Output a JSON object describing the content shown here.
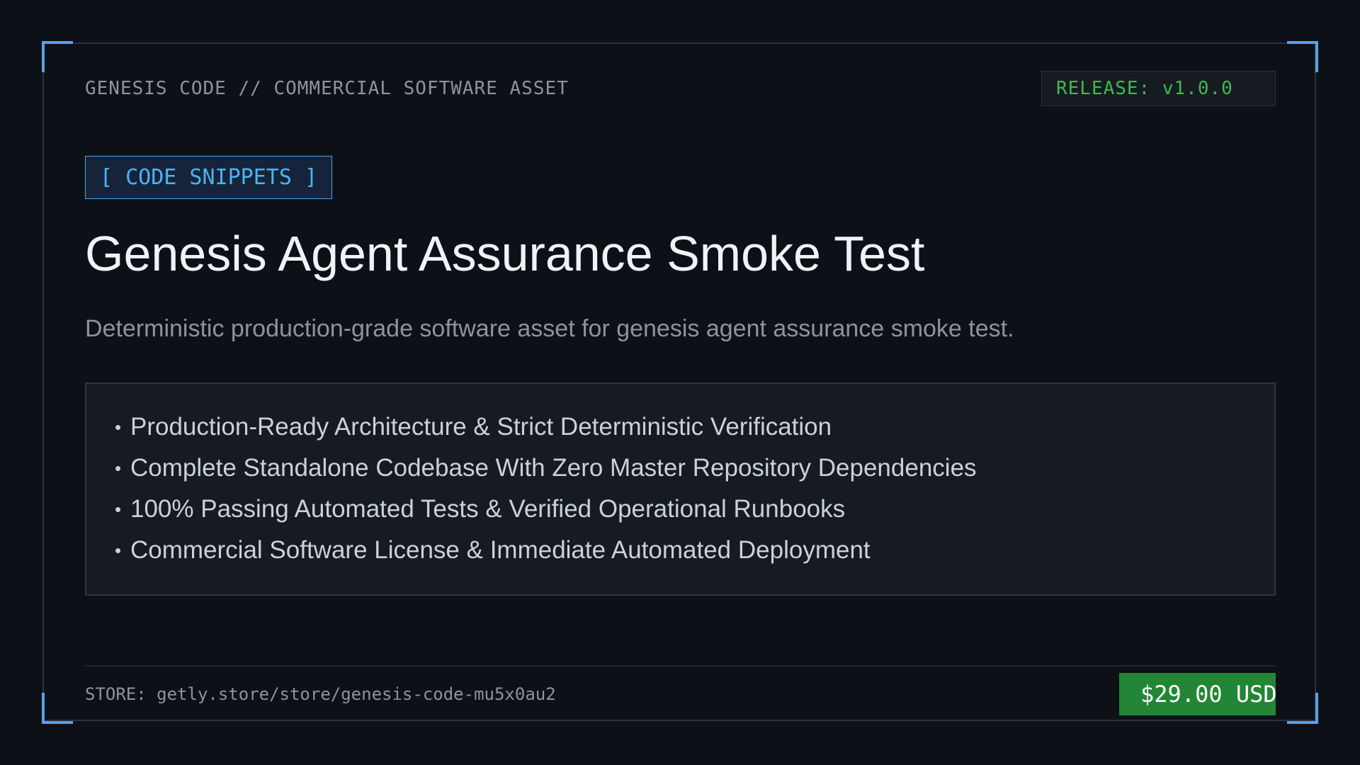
{
  "header": {
    "label": "GENESIS CODE // COMMERCIAL SOFTWARE ASSET",
    "release": "RELEASE: v1.0.0"
  },
  "category": "[ CODE SNIPPETS ]",
  "title": "Genesis Agent Assurance Smoke Test",
  "subtitle": "Deterministic production-grade software asset for genesis agent assurance smoke test.",
  "features": [
    "Production-Ready Architecture & Strict Deterministic Verification",
    "Complete Standalone Codebase With Zero Master Repository Dependencies",
    "100% Passing Automated Tests & Verified Operational Runbooks",
    "Commercial Software License & Immediate Automated Deployment"
  ],
  "bullet": "•",
  "footer": {
    "store": "STORE: getly.store/store/genesis-code-mu5x0au2",
    "price": "$29.00 USD"
  },
  "colors": {
    "background": "#0d1117",
    "accent_blue": "#4cb3f0",
    "corner_blue": "#5b9fe8",
    "release_green": "#3fb950",
    "price_green": "#238636"
  }
}
